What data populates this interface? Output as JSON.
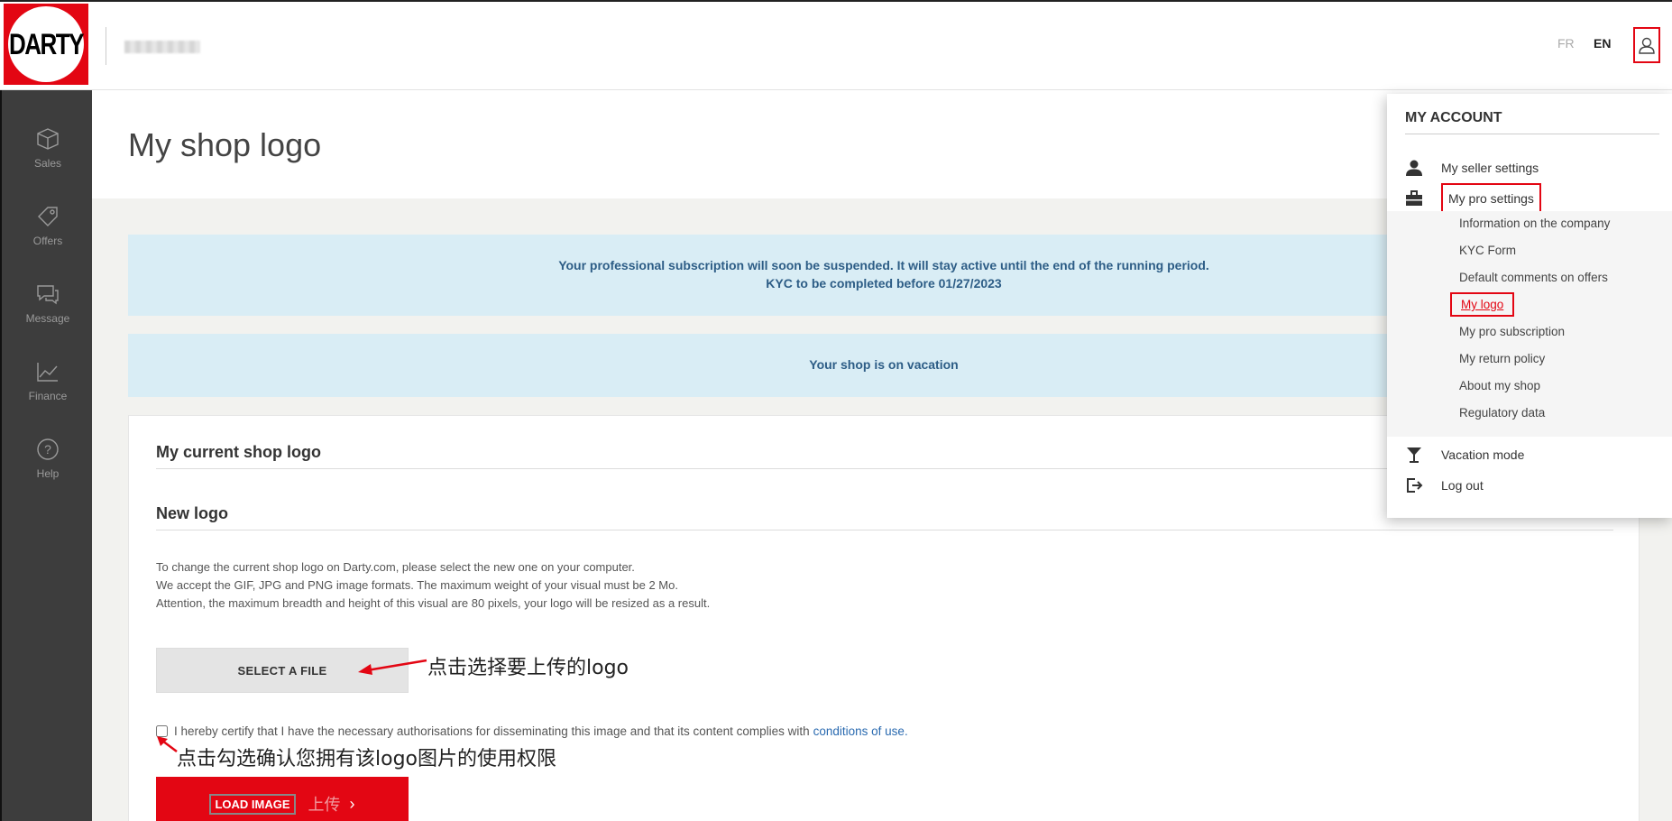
{
  "header": {
    "logo_text": "DARTY",
    "lang_fr": "FR",
    "lang_en": "EN",
    "user_icon": "user-icon"
  },
  "sidebar": {
    "items": [
      {
        "label": "Sales",
        "icon": "box-icon"
      },
      {
        "label": "Offers",
        "icon": "tag-icon"
      },
      {
        "label": "Message",
        "icon": "chat-icon"
      },
      {
        "label": "Finance",
        "icon": "chart-icon"
      },
      {
        "label": "Help",
        "icon": "help-icon"
      }
    ]
  },
  "main": {
    "title": "My shop logo",
    "banner1_line1": "Your professional subscription will soon be suspended. It will stay active until the end of the running period.",
    "banner1_line2": "KYC to be completed before 01/27/2023",
    "banner2": "Your shop is on vacation",
    "current_logo_title": "My current shop logo",
    "new_logo_title": "New logo",
    "desc_line1": "To change the current shop logo on Darty.com, please select the new one on your computer.",
    "desc_line2": "We accept the GIF, JPG and PNG image formats. The maximum weight of your visual must be 2 Mo.",
    "desc_line3": "Attention, the maximum breadth and height of this visual are 80 pixels, your logo will be resized as a result.",
    "select_file": "SELECT A FILE",
    "certify_text": "I hereby certify that I have the necessary authorisations for disseminating this image and that its content complies with",
    "conditions_link": "conditions of use.",
    "load_image": "LOAD IMAGE",
    "load_cn": "上传"
  },
  "annotations": {
    "select_hint": "点击选择要上传的logo",
    "checkbox_hint": "点击勾选确认您拥有该logo图片的使用权限"
  },
  "dropdown": {
    "title": "MY ACCOUNT",
    "seller_settings": "My seller settings",
    "pro_settings": "My pro settings",
    "sub_items": [
      "Information on the company",
      "KYC Form",
      "Default comments on offers",
      "My logo",
      "My pro subscription",
      "My return policy",
      "About my shop",
      "Regulatory data"
    ],
    "vacation": "Vacation mode",
    "logout": "Log out"
  },
  "colors": {
    "brand_red": "#e30613",
    "banner_bg": "#d9edf5",
    "banner_text": "#2d5d86",
    "sidebar_bg": "#3d3d3d"
  }
}
